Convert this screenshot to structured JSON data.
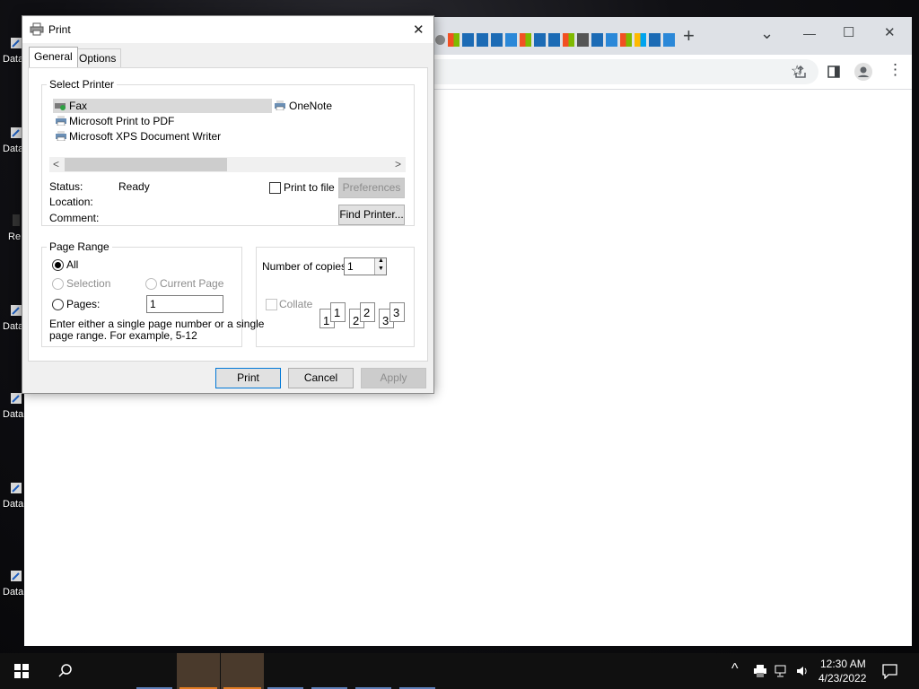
{
  "desktop": {
    "icons": [
      {
        "label": "Data"
      },
      {
        "label": "Data"
      },
      {
        "label": "Re"
      },
      {
        "label": "Data"
      },
      {
        "label": "Data"
      },
      {
        "label": "Data"
      },
      {
        "label": "Data"
      }
    ]
  },
  "browser": {
    "new_tab": "+",
    "window_controls": {
      "minimize": "—",
      "maximize": "☐",
      "close": "✕",
      "tab_search": "⌄"
    },
    "toolbar_icons": [
      "share-icon",
      "star-icon",
      "side-panel-icon",
      "profile-icon",
      "menu-icon"
    ]
  },
  "dialog": {
    "title": "Print",
    "close": "✕",
    "tabs": [
      {
        "label": "General"
      },
      {
        "label": "Options"
      }
    ],
    "select_printer": {
      "label": "Select Printer",
      "printers": [
        {
          "name": "Fax",
          "selected": true
        },
        {
          "name": "OneNote"
        },
        {
          "name": "Microsoft Print to PDF"
        },
        {
          "name": "Microsoft XPS Document Writer"
        }
      ],
      "scroll_left": "<",
      "scroll_right": ">",
      "status_label": "Status:",
      "status_value": "Ready",
      "location_label": "Location:",
      "comment_label": "Comment:",
      "print_to_file": "Print to file",
      "preferences": "Preferences",
      "find_printer": "Find Printer..."
    },
    "page_range": {
      "label": "Page Range",
      "all": "All",
      "selection": "Selection",
      "current_page": "Current Page",
      "pages": "Pages:",
      "pages_value": "1",
      "hint_line1": "Enter either a single page number or a single",
      "hint_line2": "page range.  For example, 5-12"
    },
    "copies": {
      "label": "Number of copies:",
      "value": "1",
      "collate": "Collate",
      "collate_pages": [
        "1",
        "1",
        "2",
        "2",
        "3",
        "3"
      ]
    },
    "buttons": {
      "print": "Print",
      "cancel": "Cancel",
      "apply": "Apply"
    }
  },
  "taskbar": {
    "time": "12:30 AM",
    "date": "4/23/2022"
  }
}
